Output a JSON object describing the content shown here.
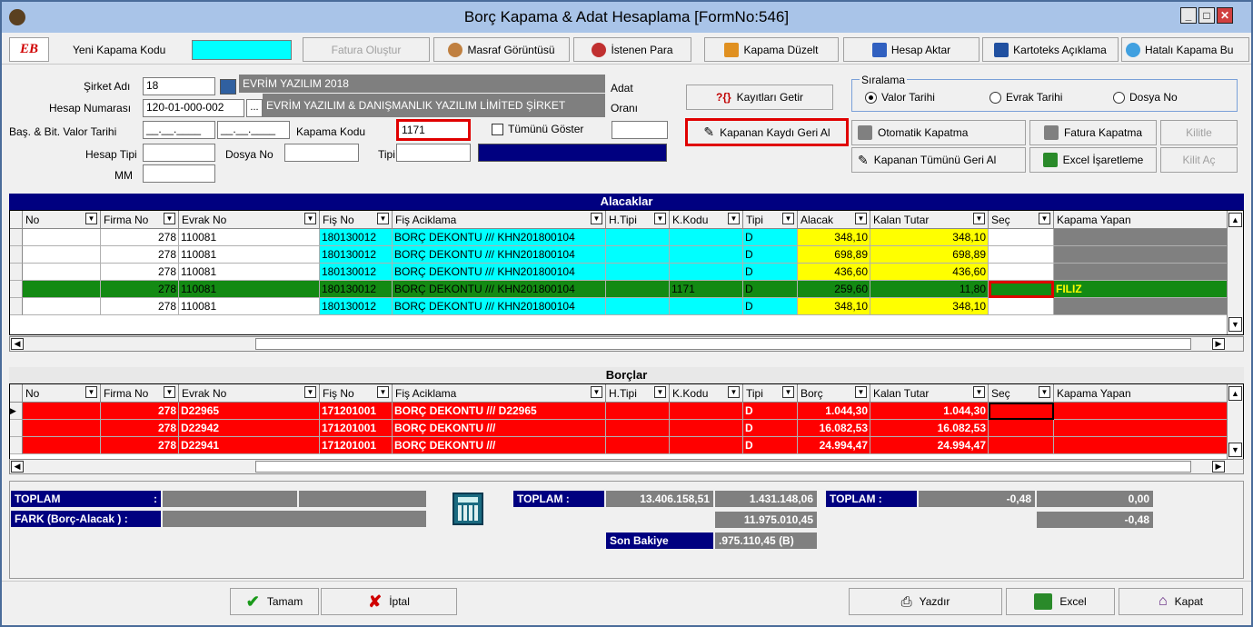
{
  "window": {
    "title": "Borç Kapama & Adat Hesaplama [FormNo:546]"
  },
  "toolbar": {
    "new_code_label": "Yeni Kapama Kodu",
    "new_code_value": "",
    "buttons": [
      "Fatura Oluştur",
      "Masraf Görüntüsü",
      "İstenen Para",
      "Kapama Düzelt",
      "Hesap Aktar",
      "Kartoteks Açıklama",
      "Hatalı Kapama Bu"
    ]
  },
  "form": {
    "company_label": "Şirket Adı",
    "company_code": "18",
    "company_name": "EVRİM YAZILIM 2018",
    "account_label": "Hesap Numarası",
    "account_number": "120-01-000-002",
    "account_ellipsis": "...",
    "account_name": "EVRİM YAZILIM & DANIŞMANLIK YAZILIM LİMİTED ŞİRKET",
    "adat_label_1": "Adat",
    "adat_label_2": "Oranı",
    "date_label": "Baş. & Bit. Valor Tarihi",
    "date_start": "__.__.____",
    "date_end": "__.__.____",
    "kapama_label": "Kapama Kodu",
    "kapama_value": "1171",
    "show_all_label": "Tümünü Göster",
    "account_type_label": "Hesap Tipi",
    "file_no_label": "Dosya No",
    "type_label": "Tipi",
    "mm_label": "MM"
  },
  "actions": {
    "get_records": "Kayıtları Getir",
    "revert_closed": "Kapanan Kaydı Geri Al",
    "auto_close": "Otomatik Kapatma",
    "revert_all": "Kapanan Tümünü Geri Al",
    "invoice_close": "Fatura Kapatma",
    "excel_mark": "Excel İşaretleme",
    "lock": "Kilitle",
    "unlock": "Kilit Aç"
  },
  "sorting": {
    "title": "Sıralama",
    "options": [
      "Valor Tarihi",
      "Evrak Tarihi",
      "Dosya No"
    ],
    "selected": "Valor Tarihi"
  },
  "receivables": {
    "title": "Alacaklar",
    "columns": [
      "No",
      "Firma No",
      "Evrak No",
      "Fiş No",
      "Fiş Aciklama",
      "H.Tipi",
      "K.Kodu",
      "Tipi",
      "Alacak",
      "Kalan Tutar",
      "Seç",
      "Kapama Yapan"
    ],
    "rows": [
      {
        "firm": "278",
        "doc": "110081",
        "voucher": "180130012",
        "desc": "BORÇ DEKONTU /// KHN201800104",
        "htype": "",
        "kcode": "",
        "type": "D",
        "amount": "348,10",
        "remaining": "348,10",
        "sel": "",
        "closer": "",
        "highlight": false
      },
      {
        "firm": "278",
        "doc": "110081",
        "voucher": "180130012",
        "desc": "BORÇ DEKONTU /// KHN201800104",
        "htype": "",
        "kcode": "",
        "type": "D",
        "amount": "698,89",
        "remaining": "698,89",
        "sel": "",
        "closer": "",
        "highlight": false
      },
      {
        "firm": "278",
        "doc": "110081",
        "voucher": "180130012",
        "desc": "BORÇ DEKONTU /// KHN201800104",
        "htype": "",
        "kcode": "",
        "type": "D",
        "amount": "436,60",
        "remaining": "436,60",
        "sel": "",
        "closer": "",
        "highlight": false
      },
      {
        "firm": "278",
        "doc": "110081",
        "voucher": "180130012",
        "desc": "BORÇ DEKONTU /// KHN201800104",
        "htype": "",
        "kcode": "1171",
        "type": "D",
        "amount": "259,60",
        "remaining": "11,80",
        "sel": "",
        "closer": "FILIZ",
        "highlight": true
      },
      {
        "firm": "278",
        "doc": "110081",
        "voucher": "180130012",
        "desc": "BORÇ DEKONTU /// KHN201800104",
        "htype": "",
        "kcode": "",
        "type": "D",
        "amount": "348,10",
        "remaining": "348,10",
        "sel": "",
        "closer": "",
        "highlight": false
      }
    ]
  },
  "payables": {
    "title": "Borçlar",
    "columns": [
      "No",
      "Firma No",
      "Evrak No",
      "Fiş No",
      "Fiş Aciklama",
      "H.Tipi",
      "K.Kodu",
      "Tipi",
      "Borç",
      "Kalan Tutar",
      "Seç",
      "Kapama Yapan"
    ],
    "rows": [
      {
        "firm": "278",
        "doc": "D22965",
        "voucher": "171201001",
        "desc": "BORÇ DEKONTU /// D22965",
        "type": "D",
        "amount": "1.044,30",
        "remaining": "1.044,30"
      },
      {
        "firm": "278",
        "doc": "D22942",
        "voucher": "171201001",
        "desc": "BORÇ DEKONTU ///",
        "type": "D",
        "amount": "16.082,53",
        "remaining": "16.082,53"
      },
      {
        "firm": "278",
        "doc": "D22941",
        "voucher": "171201001",
        "desc": "BORÇ DEKONTU ///",
        "type": "D",
        "amount": "24.994,47",
        "remaining": "24.994,47"
      }
    ]
  },
  "totals": {
    "toplam_label": "TOPLAM",
    "colon": ":",
    "fark_label": "FARK (Borç-Alacak ) :",
    "toplam2_label": "TOPLAM :",
    "toplam2_value1": "13.406.158,51",
    "toplam2_value2": "1.431.148,06",
    "diff_value": "11.975.010,45",
    "son_bakiye_label": "Son Bakiye",
    "son_bakiye_value": ".975.110,45 (B)",
    "toplam3_label": "TOPLAM :",
    "toplam3_value1": "-0,48",
    "toplam3_value2": "0,00",
    "toplam3_value3": "-0,48"
  },
  "bottom": {
    "ok": "Tamam",
    "cancel": "İptal",
    "print": "Yazdır",
    "excel": "Excel",
    "close": "Kapat"
  }
}
